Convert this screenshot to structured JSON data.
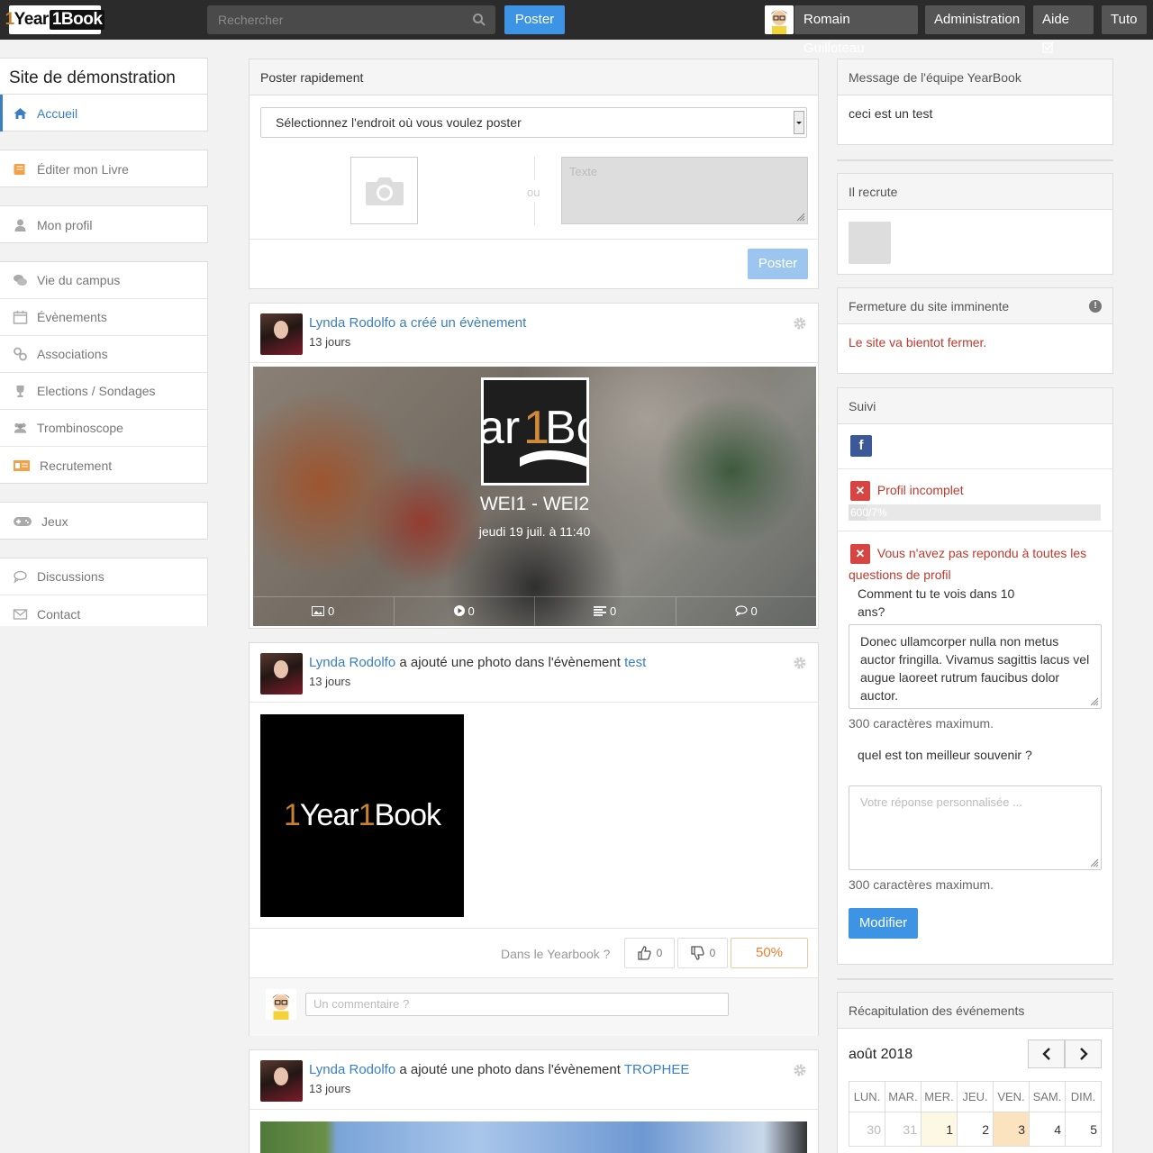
{
  "colors": {
    "accent": "#3d94e5",
    "link": "#3a7fc1",
    "warning": "#c0392b",
    "orange": "#e87f2f",
    "topbar": "#2b2b2b"
  },
  "topbar": {
    "logo": {
      "part1": "1",
      "part2": "Year",
      "part3": "1Book"
    },
    "search_placeholder": "Rechercher",
    "post_button": "Poster",
    "user_name": "Romain Guilloteau",
    "admin": "Administration",
    "help": "Aide",
    "tuto": "Tuto"
  },
  "sidebar": {
    "site_title": "Site de démonstration",
    "groups": [
      [
        {
          "label": "Accueil",
          "icon": "home-icon",
          "active": true
        }
      ],
      [
        {
          "label": "Éditer mon Livre",
          "icon": "book-icon"
        }
      ],
      [
        {
          "label": "Mon profil",
          "icon": "user-icon"
        }
      ],
      [
        {
          "label": "Vie du campus",
          "icon": "comments-icon"
        },
        {
          "label": "Évènements",
          "icon": "calendar-icon"
        },
        {
          "label": "Associations",
          "icon": "link-icon"
        },
        {
          "label": "Elections / Sondages",
          "icon": "trophy-icon"
        },
        {
          "label": "Trombinoscope",
          "icon": "users-icon"
        },
        {
          "label": "Recrutement",
          "icon": "id-card-icon"
        }
      ],
      [
        {
          "label": "Jeux",
          "icon": "gamepad-icon"
        }
      ],
      [
        {
          "label": "Discussions",
          "icon": "chat-icon"
        },
        {
          "label": "Contact",
          "icon": "envelope-icon"
        }
      ]
    ]
  },
  "quick_post": {
    "header": "Poster rapidement",
    "select_value": "Sélectionnez l'endroit où vous voulez poster",
    "or": "ou",
    "text_placeholder": "Texte",
    "submit": "Poster"
  },
  "posts": [
    {
      "author": "Lynda Rodolfo",
      "action_link": "a créé un évènement",
      "time": "13 jours",
      "event_name": "WEI1 - WEI2",
      "event_date": "jeudi 19 juil. à 11:40",
      "event_logo": "ar1Bo",
      "stats": [
        "0",
        "0",
        "0",
        "0"
      ]
    },
    {
      "author": "Lynda Rodolfo",
      "action": "a ajouté une photo dans l'évènement",
      "event_link": "test",
      "time": "13 jours",
      "image_logo": {
        "part1": "1",
        "part2": "Year",
        "part3": "1",
        "part4": "Book"
      },
      "vote_question": "Dans le Yearbook ?",
      "likes": "0",
      "dislikes": "0",
      "percent": "50%",
      "comment_placeholder": "Un commentaire ?"
    },
    {
      "author": "Lynda Rodolfo",
      "action": "a ajouté une photo dans l'évènement",
      "event_link": "TROPHEE",
      "time": "13 jours"
    }
  ],
  "right": {
    "team_msg": {
      "header": "Message de l'équipe YearBook",
      "body": "ceci est un test"
    },
    "recruit": {
      "header": "Il recrute"
    },
    "closing": {
      "header": "Fermeture du site imminente",
      "body": "Le site va bientot fermer."
    },
    "suivi": {
      "header": "Suivi",
      "profile_incomplete": "Profil incomplet",
      "progress_label": "600/7%",
      "progress": 0.07,
      "questions_warning": "Vous n'avez pas repondu à toutes les questions de profil",
      "q1": "Comment tu te vois dans 10 ans?",
      "a1": "Donec ullamcorper nulla non metus auctor fringilla. Vivamus sagittis lacus vel augue laoreet rutrum faucibus dolor auctor.",
      "max1": "300 caractères maximum.",
      "q2": "quel est ton meilleur souvenir ?",
      "a2_placeholder": "Votre réponse personnalisée ...",
      "max2": "300 caractères maximum.",
      "submit": "Modifier"
    },
    "calendar": {
      "header": "Récapitulation des événements",
      "month": "août 2018",
      "days": [
        "LUN.",
        "MAR.",
        "MER.",
        "JEU.",
        "VEN.",
        "SAM.",
        "DIM."
      ],
      "week1": [
        "30",
        "31",
        "1",
        "2",
        "3",
        "4",
        "5"
      ]
    }
  }
}
